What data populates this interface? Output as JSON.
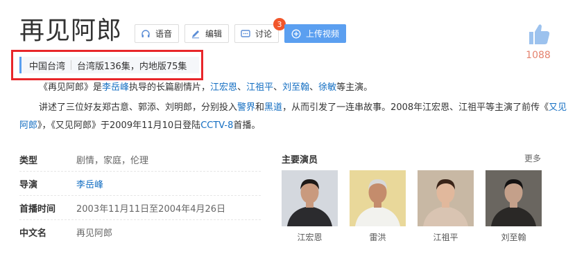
{
  "title": "再见阿郎",
  "toolbar": {
    "voice": "语音",
    "edit": "编辑",
    "discuss": "讨论",
    "discuss_badge": "3",
    "upload": "上传视频"
  },
  "like": {
    "count": "1088"
  },
  "summary": {
    "region": "中国台湾",
    "episodes": "台湾版136集，内地版75集"
  },
  "intro": {
    "p1": [
      {
        "t": "《再见阿郎》是"
      },
      {
        "t": "李岳峰",
        "link": true
      },
      {
        "t": "执导的长篇剧情片，"
      },
      {
        "t": "江宏恩",
        "link": true
      },
      {
        "t": "、"
      },
      {
        "t": "江祖平",
        "link": true
      },
      {
        "t": "、"
      },
      {
        "t": "刘至翰",
        "link": true
      },
      {
        "t": "、"
      },
      {
        "t": "徐敏",
        "link": true
      },
      {
        "t": "等主演。"
      }
    ],
    "p2": [
      {
        "t": "讲述了三位好友郑古意、郭添、刘明郎，分别投入"
      },
      {
        "t": "警界",
        "link": true
      },
      {
        "t": "和"
      },
      {
        "t": "黑道",
        "link": true
      },
      {
        "t": "，从而引发了一连串故事。2008年江宏恩、江祖平等主演了前传《"
      },
      {
        "t": "又见阿郎",
        "link": true
      },
      {
        "t": "》，《又见阿郎》于2009年11月10日登陆"
      },
      {
        "t": "CCTV-8",
        "link": true
      },
      {
        "t": "首播。"
      }
    ]
  },
  "info": [
    {
      "key": "类型",
      "value": "剧情，家庭，伦理",
      "link": false
    },
    {
      "key": "导演",
      "value": "李岳峰",
      "link": true
    },
    {
      "key": "首播时间",
      "value": "2003年11月11日至2004年4月26日",
      "link": false
    },
    {
      "key": "中文名",
      "value": "再见阿郎",
      "link": false
    }
  ],
  "actors_section": {
    "title": "主要演员",
    "more": "更多",
    "actors": [
      {
        "name": "江宏恩",
        "bg": "#d4d8de",
        "skin": "#c99a7e",
        "hair": "#1e1a18",
        "cloth": "#2b2b2e"
      },
      {
        "name": "雷洪",
        "bg": "#e9d89a",
        "skin": "#c48c6c",
        "hair": "#d8d8d8",
        "cloth": "#f2f2ee"
      },
      {
        "name": "江祖平",
        "bg": "#c8b8a4",
        "skin": "#e1b89c",
        "hair": "#3a2418",
        "cloth": "#d9c4b2"
      },
      {
        "name": "刘至翰",
        "bg": "#6a6660",
        "skin": "#c4a08a",
        "hair": "#141212",
        "cloth": "#2a2826"
      }
    ]
  },
  "colors": {
    "accent": "#5b9ff0",
    "link": "#136ec2",
    "highlight": "#e8262a",
    "like": "#e4826e"
  }
}
